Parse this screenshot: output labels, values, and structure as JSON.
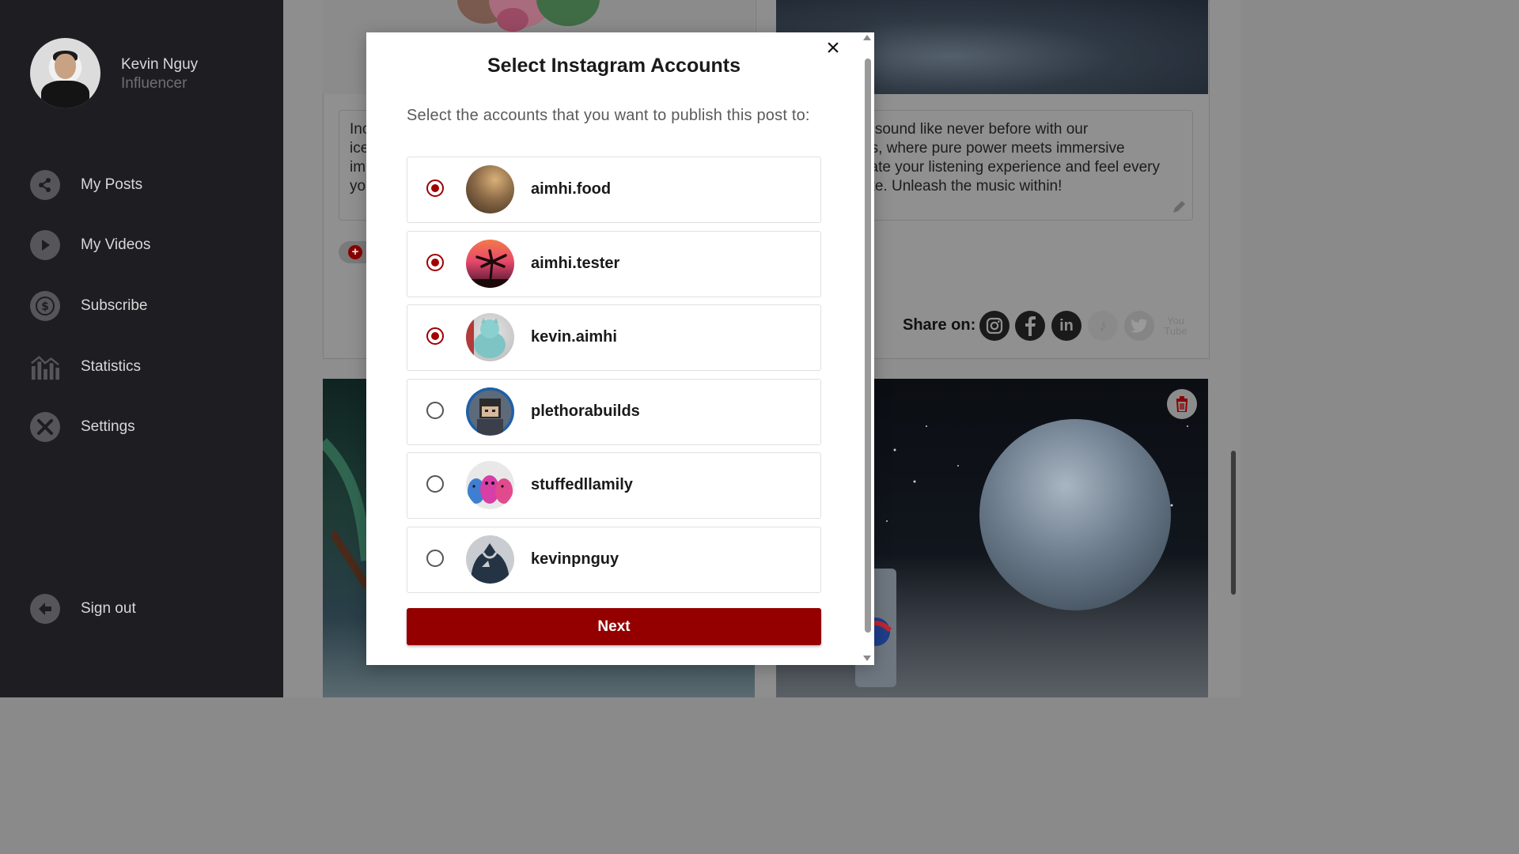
{
  "sidebar": {
    "user_name": "Kevin Nguy",
    "user_role": "Influencer",
    "collapse_label": "«",
    "items": [
      {
        "label": "My Posts",
        "icon": "share-icon"
      },
      {
        "label": "My Videos",
        "icon": "play-icon"
      },
      {
        "label": "Subscribe",
        "icon": "dollar-icon"
      },
      {
        "label": "Statistics",
        "icon": "chart-icon"
      },
      {
        "label": "Settings",
        "icon": "tools-icon"
      }
    ],
    "sign_out": "Sign out"
  },
  "posts": {
    "left_caption": "Inc\nice\nim\nyo",
    "right_caption": "e sound like never before with our\nes, where pure power meets immersive\nvate your listening experience and feel every\nate. Unleash the music within!",
    "share_label": "Share on:",
    "share_networks": [
      "instagram",
      "facebook",
      "linkedin",
      "tiktok",
      "twitter",
      "youtube"
    ]
  },
  "modal": {
    "title": "Select Instagram Accounts",
    "close_label": "×",
    "subtitle": "Select the accounts that you want to publish this post to:",
    "accounts": [
      {
        "name": "aimhi.food",
        "selected": true
      },
      {
        "name": "aimhi.tester",
        "selected": true
      },
      {
        "name": "kevin.aimhi",
        "selected": true
      },
      {
        "name": "plethorabuilds",
        "selected": false
      },
      {
        "name": "stuffedllamily",
        "selected": false
      },
      {
        "name": "kevinpnguy",
        "selected": false
      }
    ],
    "next_label": "Next"
  },
  "colors": {
    "accent": "#940000",
    "sidebar_bg": "#1d1d22",
    "radio_selected": "#a00000"
  }
}
